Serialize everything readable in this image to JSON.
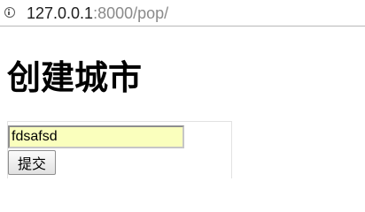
{
  "browser": {
    "url_host": "127.0.0.1",
    "url_rest": ":8000/pop/",
    "security_icon": "info-icon"
  },
  "page": {
    "title": "创建城市"
  },
  "form": {
    "input_value": "fdsafsd",
    "submit_label": "提交"
  }
}
